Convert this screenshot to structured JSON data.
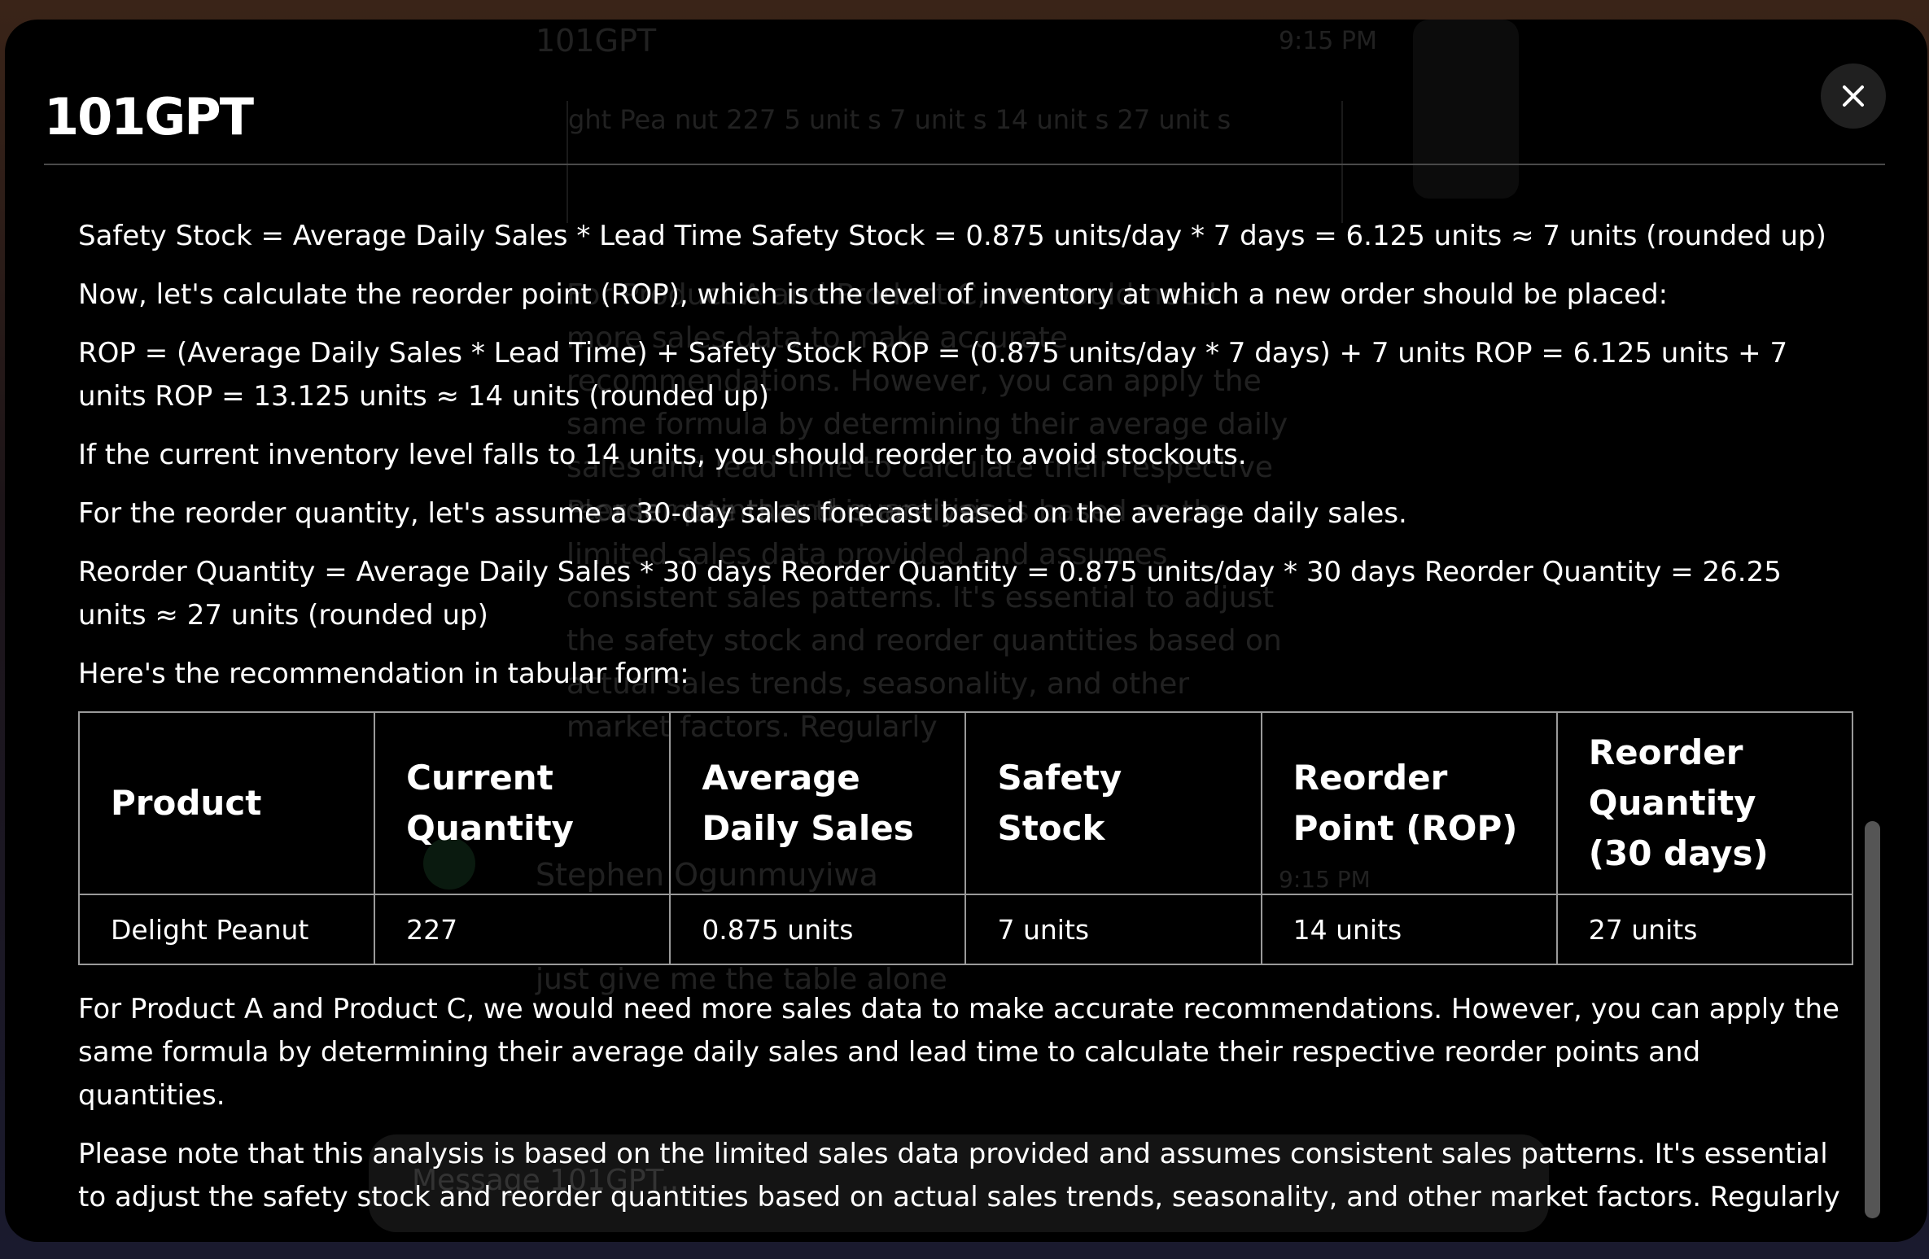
{
  "modal": {
    "title": "101GPT",
    "close_icon": "close-icon"
  },
  "background": {
    "chat_title": "101GPT",
    "time_1": "9:15 PM",
    "table_cells": [
      "ght Pea nut",
      "227",
      "5 unit s",
      "7 unit s",
      "14 unit s",
      "27 unit s"
    ],
    "paragraph_1": "For Product A and Product C, we would need more sales data to make accurate recommendations. However, you can apply the same formula by determining their average daily sales and lead time to calculate their respective reorder points and quantities.",
    "paragraph_2": "Please note that this analysis is based on the limited sales data provided and assumes consistent sales patterns. It's essential to adjust the safety stock and reorder quantities based on actual sales trends, seasonality, and other market factors. Regularly",
    "user_name": "Stephen Ogunmuyiwa",
    "time_2": "9:15 PM",
    "user_message": "just give me the table alone",
    "input_placeholder": "Message 101GPT..."
  },
  "content": {
    "p1": "Safety Stock = Average Daily Sales * Lead Time Safety Stock = 0.875 units/day * 7 days = 6.125 units ≈ 7 units (rounded up)",
    "p2": "Now, let's calculate the reorder point (ROP), which is the level of inventory at which a new order should be placed:",
    "p3": "ROP = (Average Daily Sales * Lead Time) + Safety Stock ROP = (0.875 units/day * 7 days) + 7 units ROP = 6.125 units + 7 units ROP = 13.125 units ≈ 14 units (rounded up)",
    "p4": "If the current inventory level falls to 14 units, you should reorder to avoid stockouts.",
    "p5": "For the reorder quantity, let's assume a 30-day sales forecast based on the average daily sales.",
    "p6": "Reorder Quantity = Average Daily Sales * 30 days Reorder Quantity = 0.875 units/day * 30 days Reorder Quantity = 26.25 units ≈ 27 units (rounded up)",
    "p7": "Here's the recommendation in tabular form:",
    "table": {
      "headers": [
        "Product",
        "Current Quantity",
        "Average Daily Sales",
        "Safety Stock",
        "Reorder Point (ROP)",
        "Reorder Quantity (30 days)"
      ],
      "rows": [
        [
          "Delight Peanut",
          "227",
          "0.875 units",
          "7 units",
          "14 units",
          "27 units"
        ]
      ]
    },
    "p8": "For Product A and Product C, we would need more sales data to make accurate recommendations. However, you can apply the same formula by determining their average daily sales and lead time to calculate their respective reorder points and quantities.",
    "p9": "Please note that this analysis is based on the limited sales data provided and assumes consistent sales patterns. It's essential to adjust the safety stock and reorder quantities based on actual sales trends, seasonality, and other market factors. Regularly"
  }
}
